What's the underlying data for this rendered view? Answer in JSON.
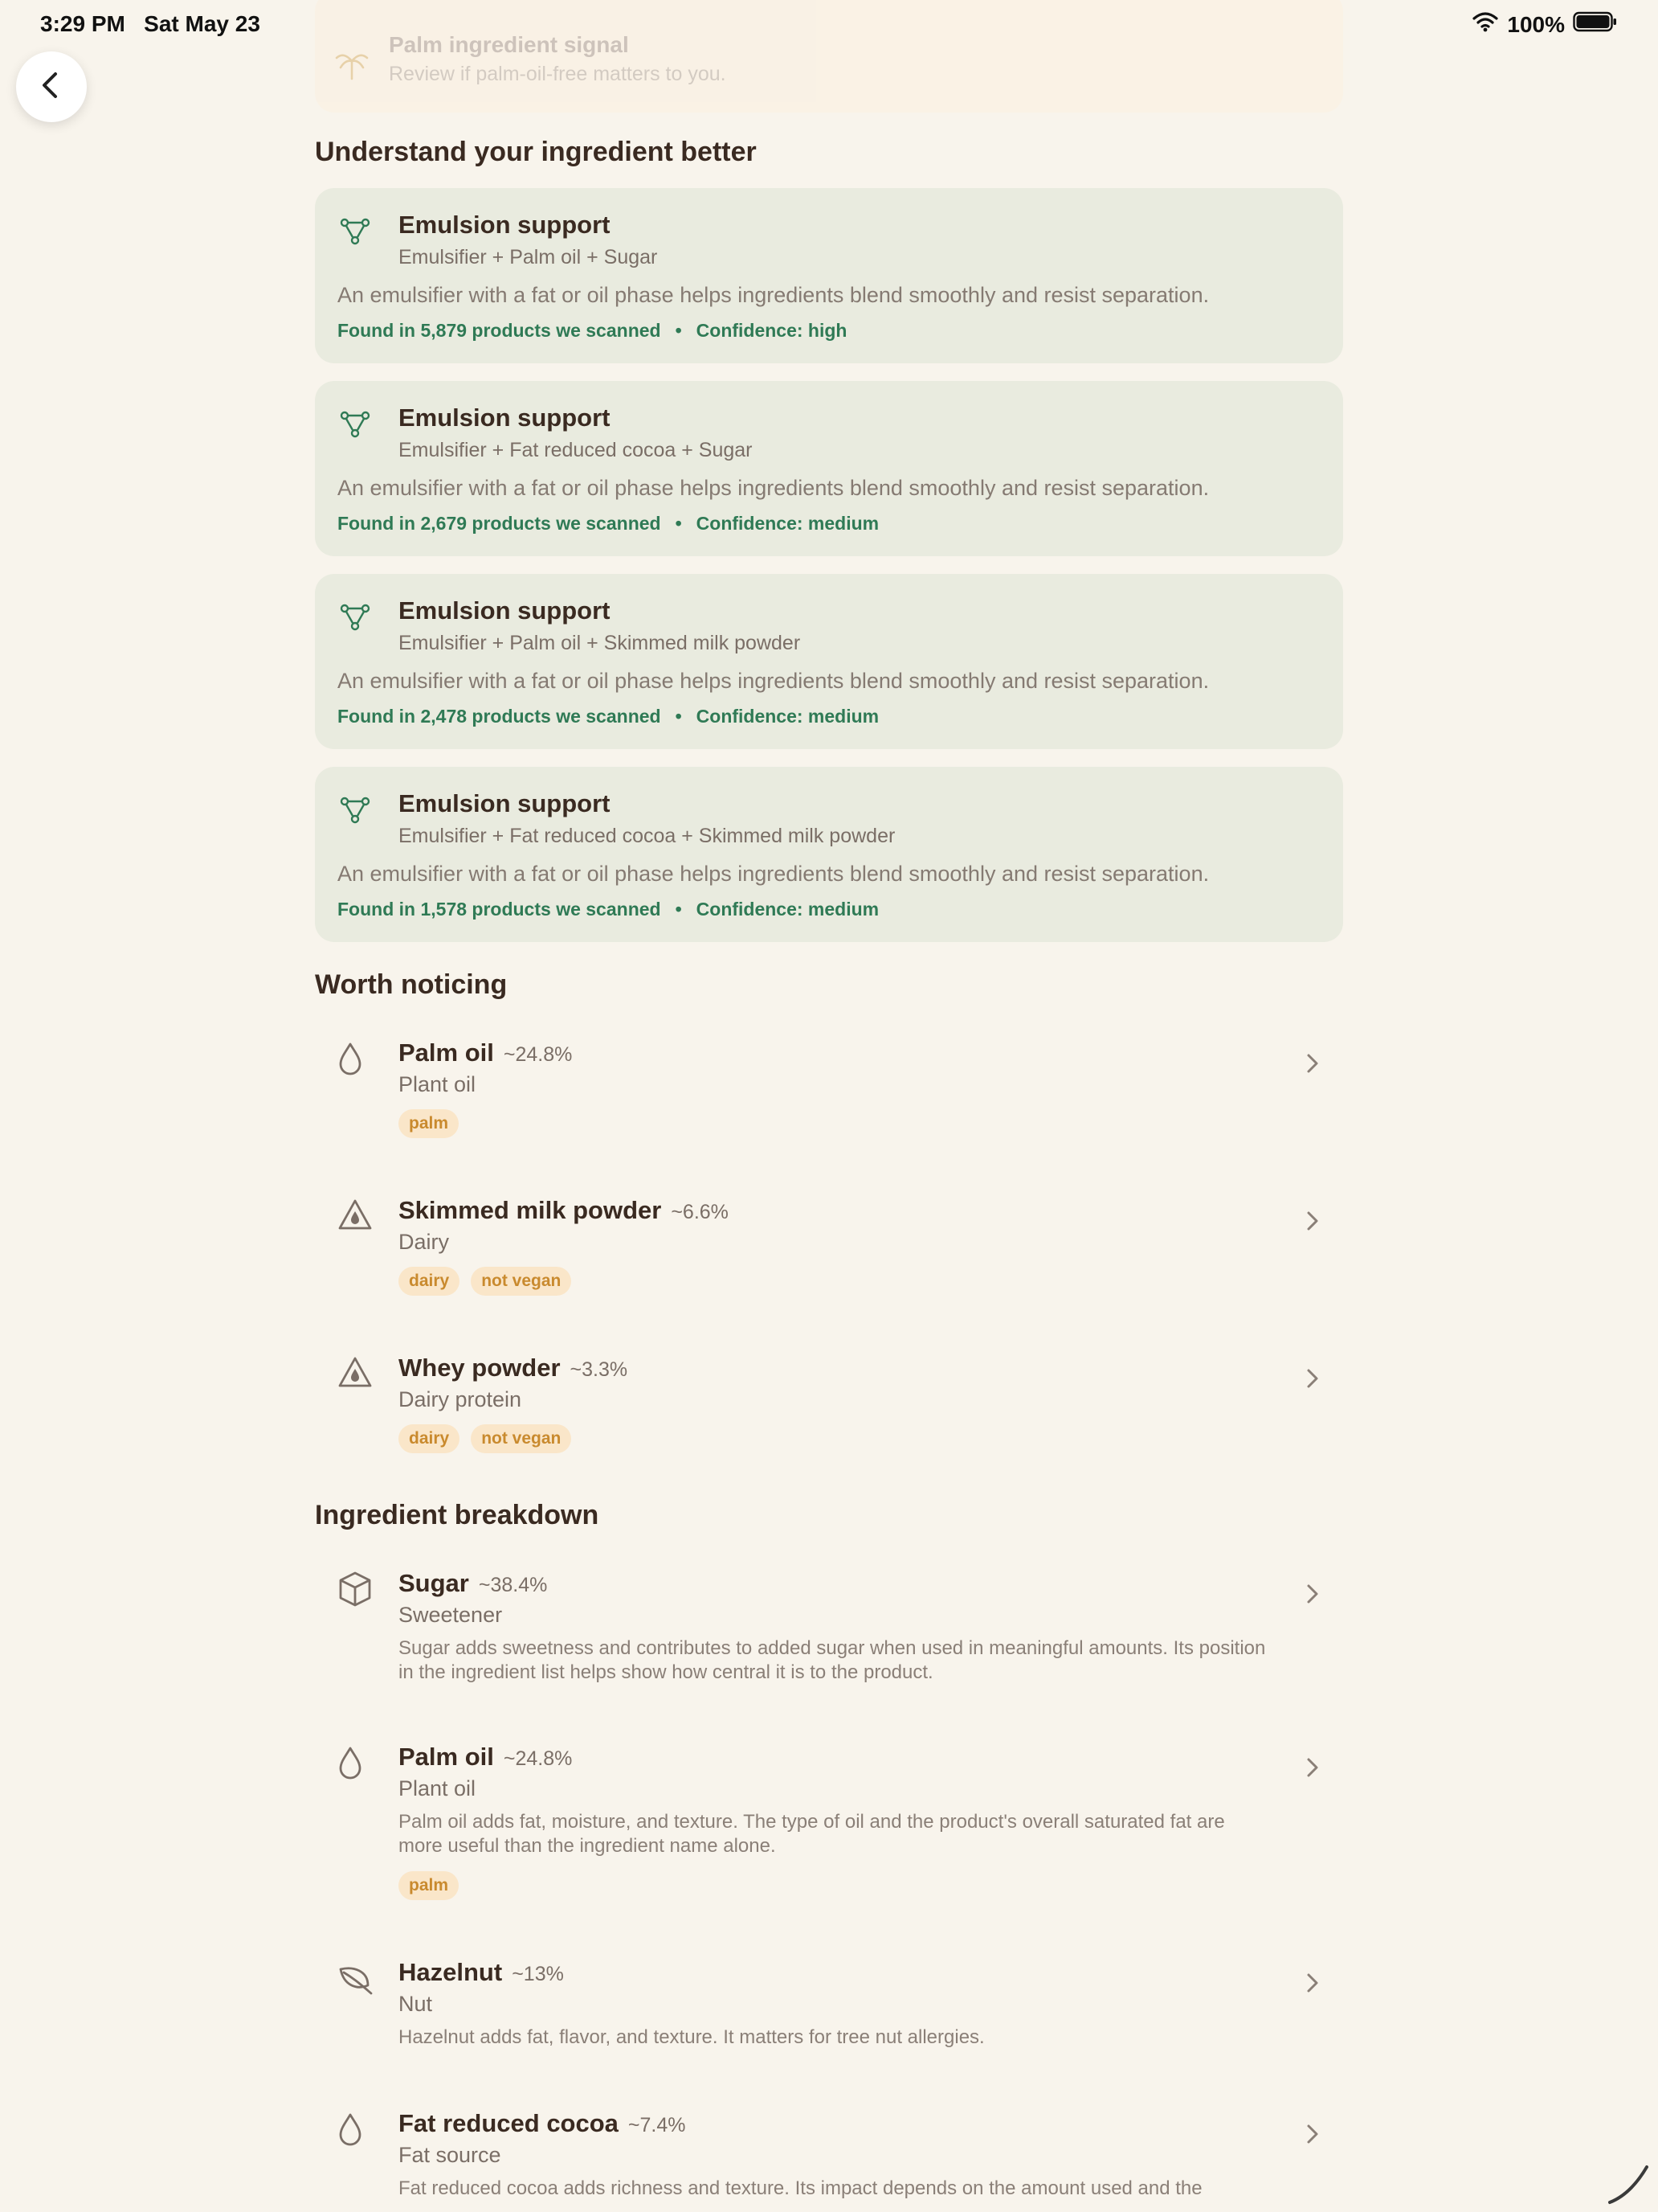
{
  "status_bar": {
    "time": "3:29 PM",
    "date": "Sat May 23",
    "battery": "100%"
  },
  "palm_signal": {
    "title": "Palm ingredient signal",
    "subtitle": "Review if palm-oil-free matters to you."
  },
  "understand": {
    "title": "Understand your ingredient better",
    "cards": [
      {
        "title": "Emulsion support",
        "combo": "Emulsifier + Palm oil + Sugar",
        "description": "An emulsifier with a fat or oil phase helps ingredients blend smoothly and resist separation.",
        "found": "Found in 5,879 products we scanned",
        "confidence": "Confidence: high"
      },
      {
        "title": "Emulsion support",
        "combo": "Emulsifier + Fat reduced cocoa + Sugar",
        "description": "An emulsifier with a fat or oil phase helps ingredients blend smoothly and resist separation.",
        "found": "Found in 2,679 products we scanned",
        "confidence": "Confidence: medium"
      },
      {
        "title": "Emulsion support",
        "combo": "Emulsifier + Palm oil + Skimmed milk powder",
        "description": "An emulsifier with a fat or oil phase helps ingredients blend smoothly and resist separation.",
        "found": "Found in 2,478 products we scanned",
        "confidence": "Confidence: medium"
      },
      {
        "title": "Emulsion support",
        "combo": "Emulsifier + Fat reduced cocoa + Skimmed milk powder",
        "description": "An emulsifier with a fat or oil phase helps ingredients blend smoothly and resist separation.",
        "found": "Found in 1,578 products we scanned",
        "confidence": "Confidence: medium"
      }
    ],
    "separator": "•"
  },
  "worth_noticing": {
    "title": "Worth noticing",
    "items": [
      {
        "name": "Palm oil",
        "pct": "~24.8%",
        "category": "Plant oil",
        "tags": [
          "palm"
        ],
        "icon": "drop-icon"
      },
      {
        "name": "Skimmed milk powder",
        "pct": "~6.6%",
        "category": "Dairy",
        "tags": [
          "dairy",
          "not vegan"
        ],
        "icon": "warning-drop-icon"
      },
      {
        "name": "Whey powder",
        "pct": "~3.3%",
        "category": "Dairy protein",
        "tags": [
          "dairy",
          "not vegan"
        ],
        "icon": "warning-drop-icon"
      }
    ]
  },
  "breakdown": {
    "title": "Ingredient breakdown",
    "items": [
      {
        "name": "Sugar",
        "pct": "~38.4%",
        "category": "Sweetener",
        "description": "Sugar adds sweetness and contributes to added sugar when used in meaningful amounts. Its position in the ingredient list helps show how central it is to the product.",
        "tags": [],
        "icon": "cube-icon"
      },
      {
        "name": "Palm oil",
        "pct": "~24.8%",
        "category": "Plant oil",
        "description": "Palm oil adds fat, moisture, and texture. The type of oil and the product's overall saturated fat are more useful than the ingredient name alone.",
        "tags": [
          "palm"
        ],
        "icon": "drop-icon"
      },
      {
        "name": "Hazelnut",
        "pct": "~13%",
        "category": "Nut",
        "description": "Hazelnut adds fat, flavor, and texture. It matters for tree nut allergies.",
        "tags": [],
        "icon": "leaf-icon"
      },
      {
        "name": "Fat reduced cocoa",
        "pct": "~7.4%",
        "category": "Fat source",
        "description": "Fat reduced cocoa adds richness and texture. Its impact depends on the amount used and the",
        "tags": [],
        "icon": "drop-icon"
      }
    ]
  },
  "colors": {
    "background": "#F8F4EC",
    "card": "#E9EBDF",
    "accent_green": "#2F7A55",
    "tag_bg": "#FAE6C9",
    "tag_text": "#C98A2E"
  }
}
